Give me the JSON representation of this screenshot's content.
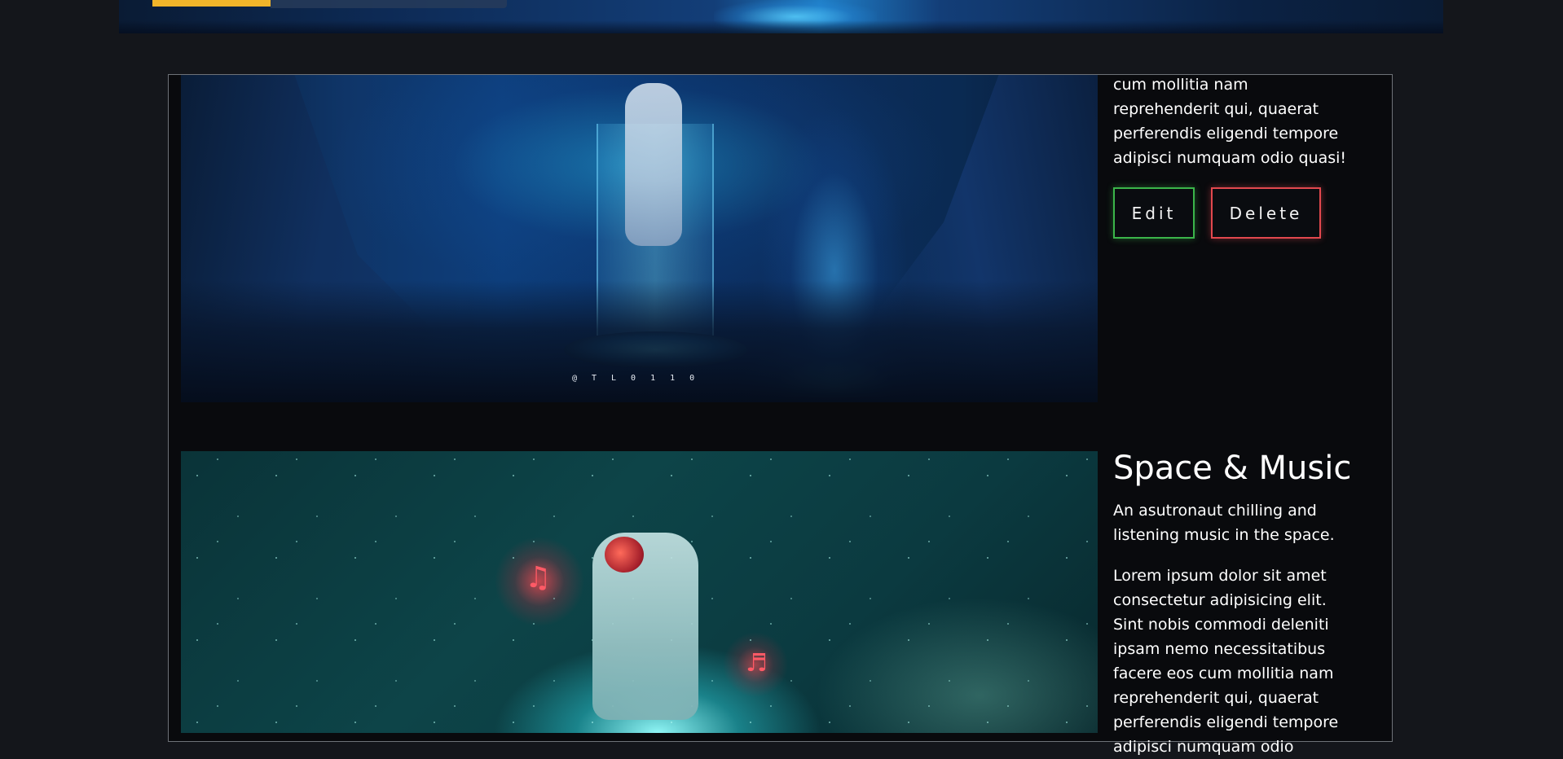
{
  "cards": [
    {
      "image_credit": "@TL0110",
      "description_tail": "cum mollitia nam reprehenderit qui, quaerat perferendis eligendi tempore adipisci numquam odio quasi!",
      "edit_label": "Edit",
      "delete_label": "Delete"
    },
    {
      "title": "Space & Music",
      "subtitle": "An asutronaut chilling and listening music in the space.",
      "description": "Lorem ipsum dolor sit amet consectetur adipisicing elit. Sint nobis commodi deleniti ipsam nemo necessitatibus facere eos cum mollitia nam reprehenderit qui, quaerat perferendis eligendi tempore adipisci numquam odio"
    }
  ],
  "colors": {
    "page_background": "#14161b",
    "panel_background": "#090a0d",
    "panel_border": "#6e7278",
    "edit_border": "#3bb54a",
    "delete_border": "#e2484e"
  },
  "icons": [
    "music-note-icon",
    "music-note-icon"
  ]
}
